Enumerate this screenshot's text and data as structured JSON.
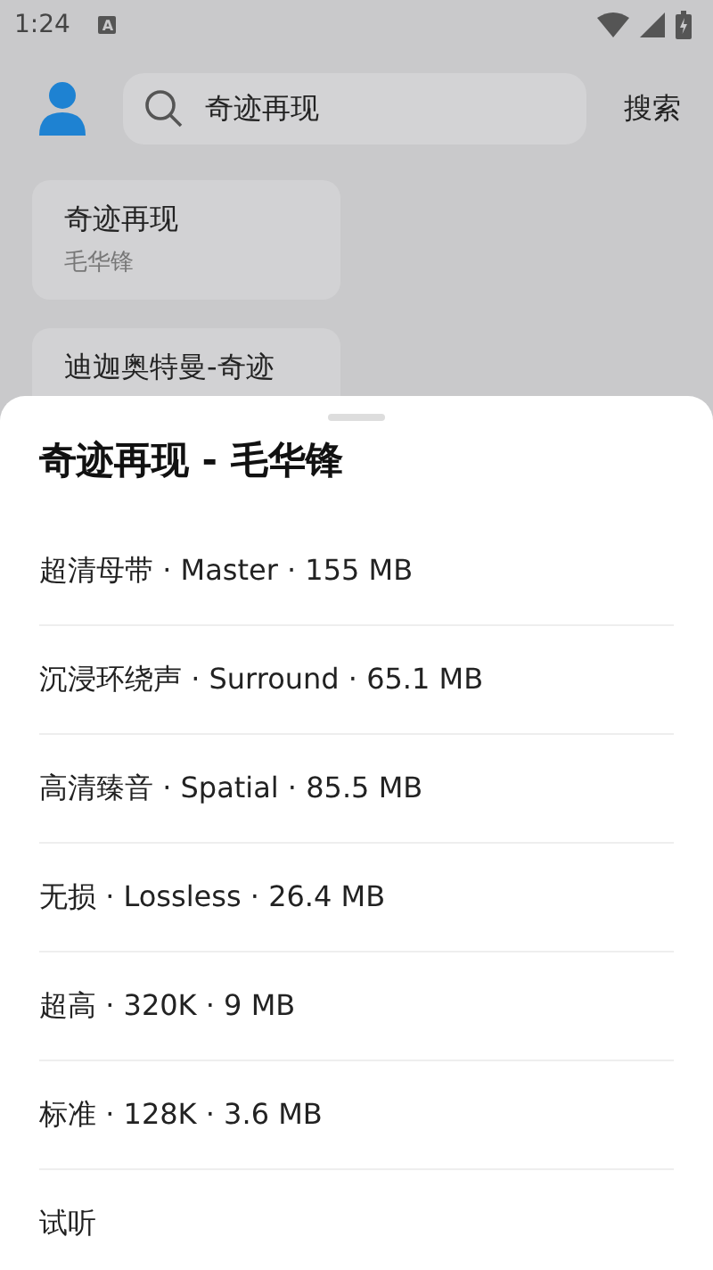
{
  "status_bar": {
    "time": "1:24",
    "notification_icon": "A"
  },
  "header": {
    "search": {
      "value": "奇迹再现"
    },
    "search_button": "搜索"
  },
  "results": [
    {
      "title": "奇迹再现",
      "subtitle": "毛华锋"
    },
    {
      "title": "迪迦奥特曼-奇迹"
    }
  ],
  "sheet": {
    "title": "奇迹再现 - 毛华锋",
    "options": [
      {
        "label": "超清母带 · Master · 155 MB"
      },
      {
        "label": "沉浸环绕声 · Surround · 65.1 MB"
      },
      {
        "label": "高清臻音 · Spatial · 85.5 MB"
      },
      {
        "label": "无损 · Lossless · 26.4 MB"
      },
      {
        "label": "超高 · 320K · 9 MB"
      },
      {
        "label": "标准 · 128K · 3.6 MB"
      },
      {
        "label": "试听"
      }
    ]
  }
}
